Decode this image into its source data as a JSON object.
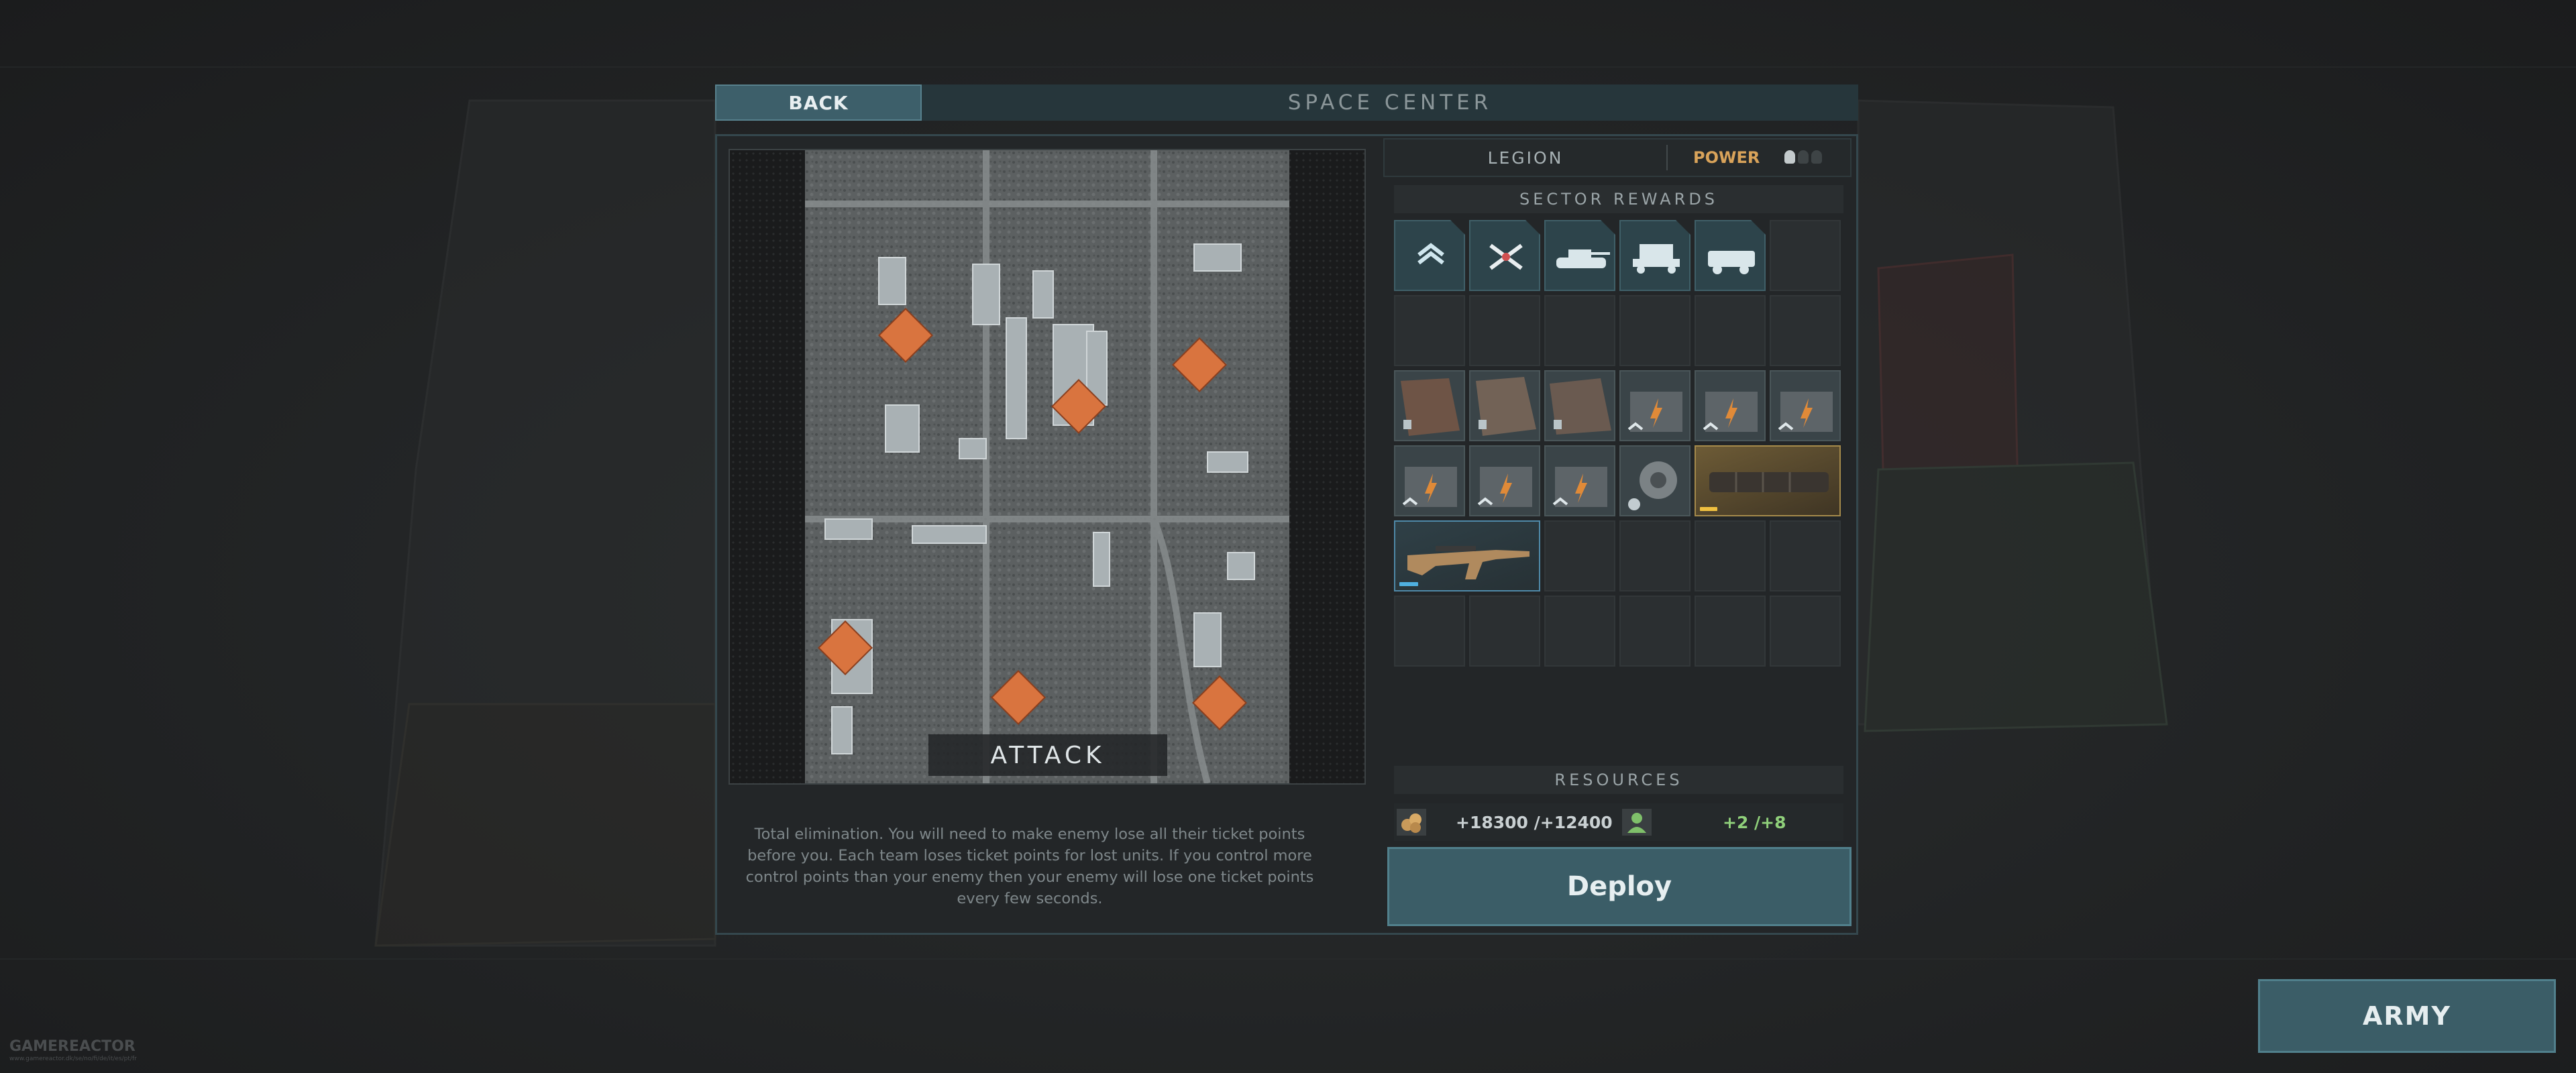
{
  "topbar": {
    "back_label": "BACK",
    "title": "SPACE CENTER"
  },
  "map": {
    "mode_label": "ATTACK",
    "description": "Total elimination. You will need to make enemy lose all their ticket points before you. Each team loses ticket points for lost units. If you control more control points than your enemy then your enemy will lose one ticket points every few seconds."
  },
  "faction": {
    "name": "LEGION",
    "power_label": "POWER",
    "power_level": 1,
    "power_max": 3
  },
  "rewards": {
    "header": "SECTOR REWARDS",
    "top_row_icons": [
      "rank-chevron-icon",
      "crossed-weapons-icon",
      "tank-icon",
      "rocket-launcher-icon",
      "armored-truck-icon"
    ],
    "item_icons": [
      "armor-plate-icon",
      "armor-plate-icon",
      "armor-plate-icon",
      "ammo-crate-icon",
      "ammo-crate-icon",
      "ammo-crate-icon",
      "ammo-crate-icon",
      "ammo-crate-icon",
      "ammo-crate-icon",
      "turbine-icon",
      "minigun-icon",
      "assault-rifle-icon"
    ]
  },
  "resources": {
    "header": "RESOURCES",
    "supplies": "+18300 /+12400",
    "manpower": "+2 /+8",
    "supplies_color": "#c9d0d2",
    "manpower_color": "#8fcf7a"
  },
  "actions": {
    "deploy_label": "Deploy",
    "army_label": "ARMY"
  },
  "watermark": {
    "brand": "GAMEREACTOR",
    "url": "www.gamereactor.dk/se/no/fi/de/it/es/pt/fr"
  },
  "colors": {
    "accent": "#3b5d67",
    "objective": "#d9743f",
    "gold": "#d9a35a"
  }
}
